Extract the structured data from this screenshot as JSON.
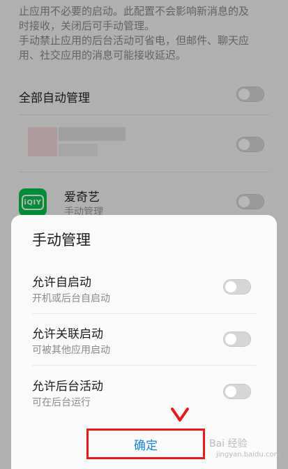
{
  "background": {
    "description_lines": [
      "止应用不必要的启动。此配置不会影响新消息的及",
      "时接收，关闭后可手动管理。",
      "手动禁止应用的后台活动可省电，但邮件、聊天应",
      "用、社交应用的消息可能接收延迟。"
    ],
    "all_auto_label": "全部自动管理",
    "app_name": "爱奇艺",
    "app_sub": "手动管理",
    "app_icon_text": "iQIY"
  },
  "dialog": {
    "title": "手动管理",
    "options": [
      {
        "title": "允许自启动",
        "subtitle": "开机或后台自启动"
      },
      {
        "title": "允许关联启动",
        "subtitle": "可被其他应用启动"
      },
      {
        "title": "允许后台活动",
        "subtitle": "可在后台运行"
      }
    ],
    "confirm_label": "确定"
  },
  "watermark": {
    "main": "Bai 经验",
    "sub": "jingyan.baidu.com"
  },
  "colors": {
    "accent": "#1a82d4",
    "highlight_border": "#e21b1b",
    "app_icon": "#00c34d"
  }
}
